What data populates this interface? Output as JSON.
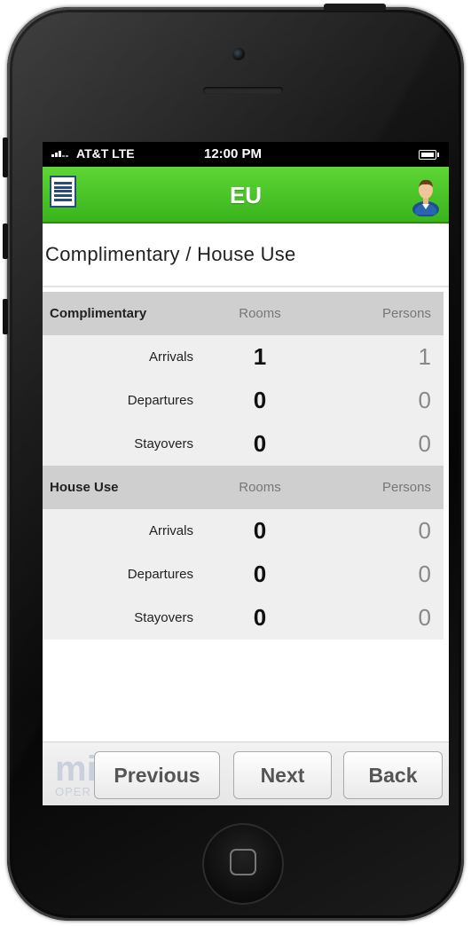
{
  "status_bar": {
    "carrier": "AT&T  LTE",
    "time": "12:00 PM"
  },
  "header": {
    "title": "EU"
  },
  "page": {
    "title": "Complimentary / House Use"
  },
  "sections": [
    {
      "name": "Complimentary",
      "col_rooms": "Rooms",
      "col_persons": "Persons",
      "rows": [
        {
          "label": "Arrivals",
          "rooms": "1",
          "persons": "1"
        },
        {
          "label": "Departures",
          "rooms": "0",
          "persons": "0"
        },
        {
          "label": "Stayovers",
          "rooms": "0",
          "persons": "0"
        }
      ]
    },
    {
      "name": "House Use",
      "col_rooms": "Rooms",
      "col_persons": "Persons",
      "rows": [
        {
          "label": "Arrivals",
          "rooms": "0",
          "persons": "0"
        },
        {
          "label": "Departures",
          "rooms": "0",
          "persons": "0"
        },
        {
          "label": "Stayovers",
          "rooms": "0",
          "persons": "0"
        }
      ]
    }
  ],
  "footer": {
    "logo_text": "mi",
    "logo_sub": "OPER",
    "previous_label": "Previous",
    "next_label": "Next",
    "back_label": "Back"
  },
  "colors": {
    "header_green": "#3cb81f",
    "section_gray": "#cfcfcf"
  },
  "icons": {
    "menu": "menu-icon",
    "user": "user-icon",
    "signal": "signal-icon",
    "battery": "battery-icon"
  }
}
